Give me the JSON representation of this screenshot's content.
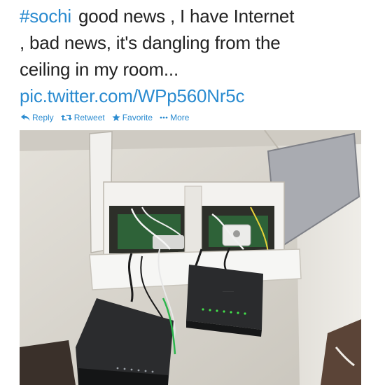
{
  "tweet": {
    "hashtag": "#sochi",
    "text_lines": [
      "good news , I have Internet",
      ", bad news,  it's dangling from the",
      "ceiling  in my room..."
    ],
    "link": "pic.twitter.com/WPp560Nr5c"
  },
  "actions": {
    "reply": "Reply",
    "retweet": "Retweet",
    "favorite": "Favorite",
    "more": "More"
  },
  "colors": {
    "link": "#2a8bd0",
    "text": "#222222"
  },
  "icons": [
    "reply-icon",
    "retweet-icon",
    "star-icon",
    "ellipsis-icon"
  ]
}
